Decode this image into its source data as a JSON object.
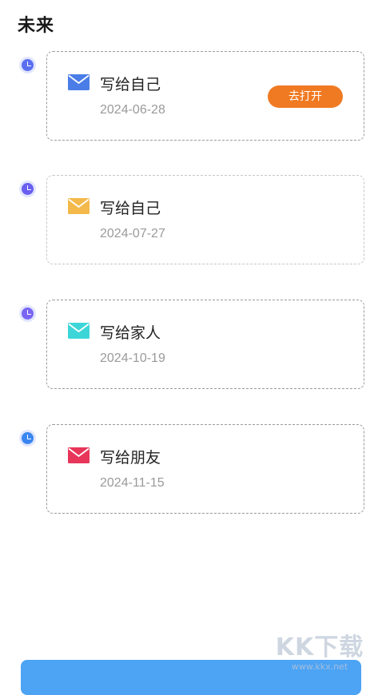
{
  "page": {
    "title": "未来"
  },
  "letters": [
    {
      "title": "写给自己",
      "date": "2024-06-28",
      "envelope_color": "#4a7de8",
      "dot_color": "#5a6ff0",
      "open_button": "去打开"
    },
    {
      "title": "写给自己",
      "date": "2024-07-27",
      "envelope_color": "#f3b94a",
      "dot_color": "#6a5ff0"
    },
    {
      "title": "写给家人",
      "date": "2024-10-19",
      "envelope_color": "#3dd6d8",
      "dot_color": "#7a66f2"
    },
    {
      "title": "写给朋友",
      "date": "2024-11-15",
      "envelope_color": "#e8355a",
      "dot_color": "#3a86f0"
    }
  ],
  "colors": {
    "accent_orange": "#f07a22",
    "bottom_button": "#4da3f4"
  },
  "icons": {
    "timeline_dot": "clock-icon",
    "letter": "envelope-icon"
  },
  "watermark": {
    "logo": "KK下载",
    "url": "www.kkx.net"
  }
}
